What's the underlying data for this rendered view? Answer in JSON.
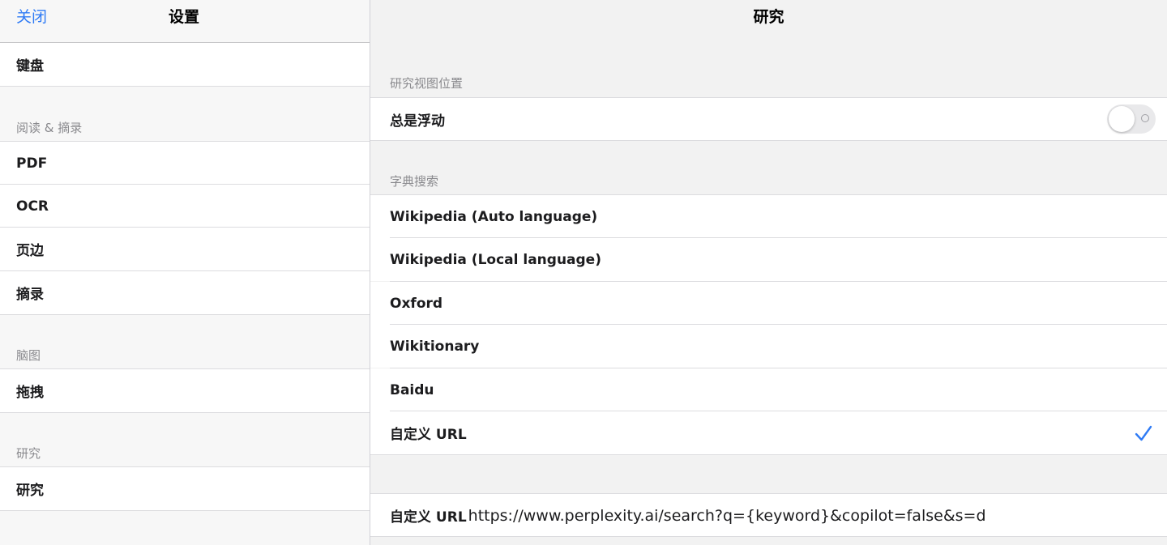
{
  "sidebar": {
    "close_label": "关闭",
    "title": "设置",
    "items": [
      {
        "label": "键盘"
      },
      {
        "section": "阅读 & 摘录"
      },
      {
        "label": "PDF"
      },
      {
        "label": "OCR"
      },
      {
        "label": "页边"
      },
      {
        "label": "摘录"
      },
      {
        "section": "脑图"
      },
      {
        "label": "拖拽"
      },
      {
        "section": "研究"
      },
      {
        "label": "研究"
      }
    ]
  },
  "detail": {
    "title": "研究",
    "view_position": {
      "section": "研究视图位置",
      "always_float_label": "总是浮动",
      "always_float_on": false
    },
    "dictionary": {
      "section": "字典搜索",
      "options": [
        {
          "label": "Wikipedia (Auto language)",
          "selected": false
        },
        {
          "label": "Wikipedia (Local language)",
          "selected": false
        },
        {
          "label": "Oxford",
          "selected": false
        },
        {
          "label": "Wikitionary",
          "selected": false
        },
        {
          "label": "Baidu",
          "selected": false
        },
        {
          "label": "自定义 URL",
          "selected": true
        }
      ]
    },
    "custom_url": {
      "label": "自定义 URL",
      "value": "https://www.perplexity.ai/search?q={keyword}&copilot=false&s=d"
    }
  },
  "colors": {
    "accent": "#2f7bf5",
    "background": "#f2f2f2",
    "row": "#ffffff",
    "section_text": "#8a8a8e"
  },
  "icons": {
    "selected": "checkmark-icon",
    "toggle_off": "toggle-off-icon"
  }
}
